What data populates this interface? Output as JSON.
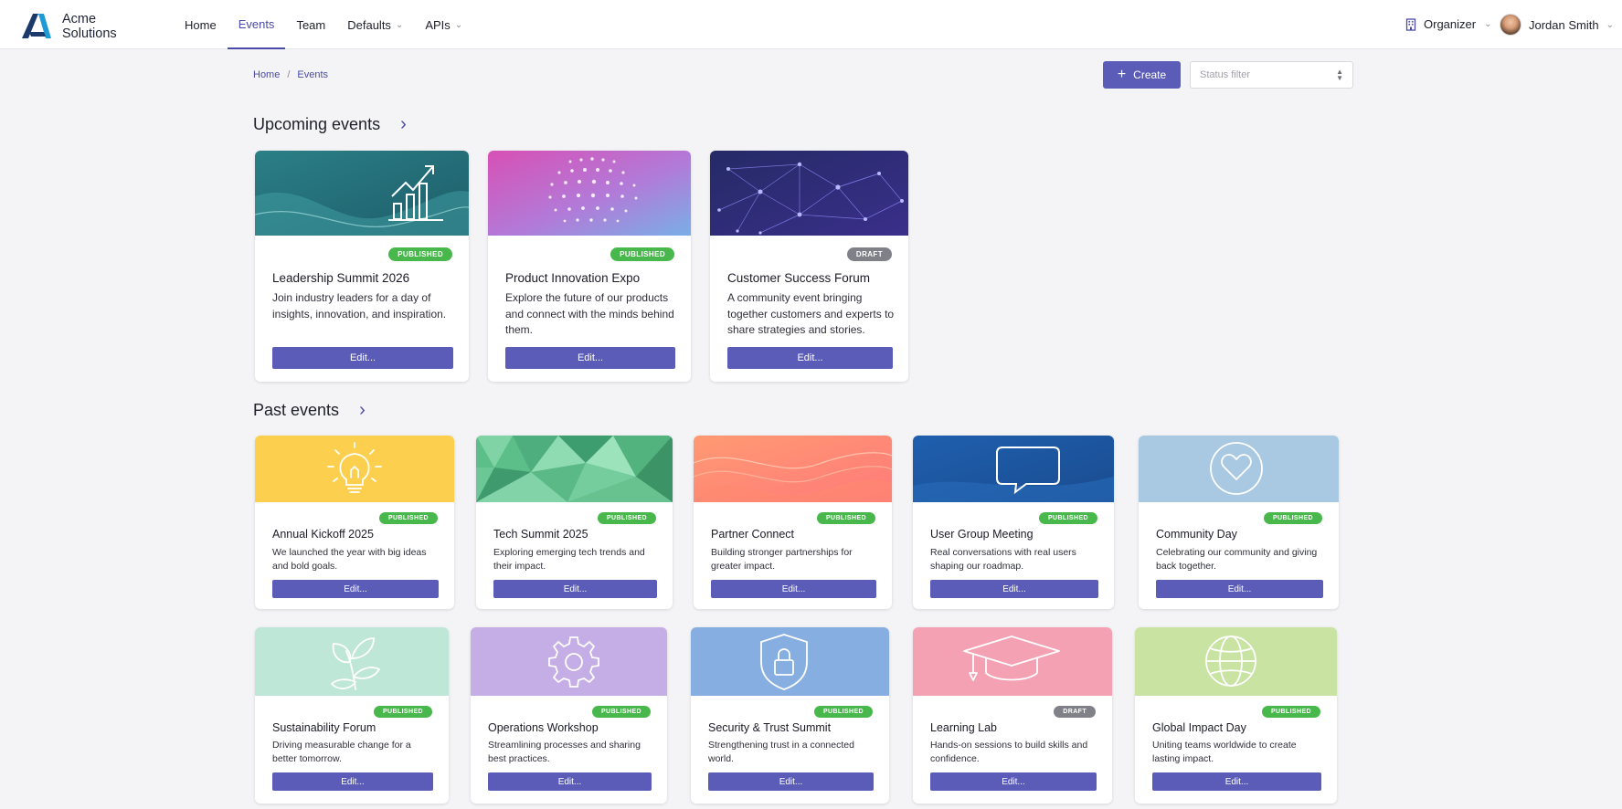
{
  "brand": {
    "line1": "Acme",
    "line2": "Solutions"
  },
  "nav": {
    "home": "Home",
    "events": "Events",
    "team": "Team",
    "defaults": "Defaults",
    "apis": "APIs"
  },
  "header": {
    "organizer": "Organizer",
    "user_name": "Jordan Smith"
  },
  "breadcrumb": {
    "home": "Home",
    "separator": "/",
    "current": "Events"
  },
  "toolbar": {
    "create_label": "Create",
    "status_filter_placeholder": "Status filter"
  },
  "sections": {
    "upcoming": "Upcoming events",
    "past": "Past events"
  },
  "upcoming_events": [
    {
      "title": "Leadership Summit 2026",
      "status": "PUBLISHED",
      "desc": "Join industry leaders for a day of insights, innovation, and inspiration.",
      "edit": "Edit...",
      "image": "growth-chart"
    },
    {
      "title": "Product Innovation Expo",
      "status": "PUBLISHED",
      "desc": "Explore the future of our products and connect with the minds behind them.",
      "edit": "Edit...",
      "image": "dot-pattern"
    },
    {
      "title": "Customer Success Forum",
      "status": "DRAFT",
      "desc": "A community event bringing together customers and experts to share strategies and stories.",
      "edit": "Edit...",
      "image": "network-mesh"
    }
  ],
  "past_events": [
    {
      "title": "Annual Kickoff 2025",
      "status": "PUBLISHED",
      "desc": "We launched the year with big ideas and bold goals.",
      "edit": "Edit...",
      "image": "lightbulb-icon"
    },
    {
      "title": "Tech Summit 2025",
      "status": "PUBLISHED",
      "desc": "Exploring emerging tech trends and their impact.",
      "edit": "Edit...",
      "image": "polygon-pattern"
    },
    {
      "title": "Partner Connect",
      "status": "PUBLISHED",
      "desc": "Building stronger partnerships for greater impact.",
      "edit": "Edit...",
      "image": "wave-pattern"
    },
    {
      "title": "User Group Meeting",
      "status": "PUBLISHED",
      "desc": "Real conversations with real users shaping our roadmap.",
      "edit": "Edit...",
      "image": "chat-bubble-icon"
    },
    {
      "title": "Community Day",
      "status": "PUBLISHED",
      "desc": "Celebrating our community and giving back together.",
      "edit": "Edit...",
      "image": "heart-icon"
    },
    {
      "title": "Sustainability Forum",
      "status": "PUBLISHED",
      "desc": "Driving measurable change for a better tomorrow.",
      "edit": "Edit...",
      "image": "sprout-icon"
    },
    {
      "title": "Operations Workshop",
      "status": "PUBLISHED",
      "desc": "Streamlining processes and sharing best practices.",
      "edit": "Edit...",
      "image": "gear-icon"
    },
    {
      "title": "Security & Trust Summit",
      "status": "PUBLISHED",
      "desc": "Strengthening trust in a connected world.",
      "edit": "Edit...",
      "image": "shield-lock-icon"
    },
    {
      "title": "Learning Lab",
      "status": "DRAFT",
      "desc": "Hands-on sessions to build skills and confidence.",
      "edit": "Edit...",
      "image": "graduation-cap-icon"
    },
    {
      "title": "Global Impact Day",
      "status": "PUBLISHED",
      "desc": "Uniting teams worldwide to create lasting impact.",
      "edit": "Edit...",
      "image": "globe-icon"
    }
  ],
  "colors": {
    "accent": "#5b5cb7",
    "published": "#49b84c",
    "draft": "#808188",
    "nav_active": "#4a4aa8"
  }
}
